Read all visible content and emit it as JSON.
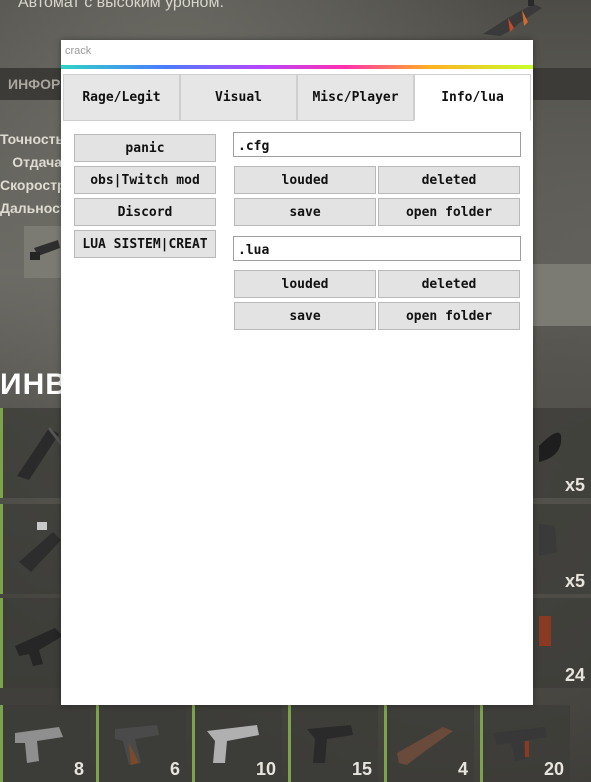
{
  "background": {
    "subtitle": "Автомат с высоким уроном.",
    "info_tab": "ИНФОРМАЦИЯ",
    "stats": [
      "Точность",
      "Отдача",
      "Скорострельность",
      "Дальность"
    ],
    "inventory_title": "ИНВЕНТАРЬ",
    "inventory_counts": {
      "r1_right": "x5",
      "r2_right": "x5",
      "r3_right": "24",
      "b1": "8",
      "b2": "6",
      "b3": "10",
      "b4": "15",
      "b5": "4",
      "b6": "20"
    }
  },
  "window": {
    "title": "crack",
    "tabs": [
      "Rage/Legit",
      "Visual",
      "Misc/Player",
      "Info/lua"
    ],
    "active_tab": "Info/lua"
  },
  "left_buttons": {
    "panic": "panic",
    "obs": "obs|Twitch mod",
    "discord": "Discord",
    "lua_sistem": "LUA SISTEM|CREAT"
  },
  "cfg": {
    "input_value": ".cfg",
    "load": "louded",
    "delete": "deleted",
    "save": "save",
    "open_folder": "open folder"
  },
  "lua": {
    "input_value": ".lua",
    "load": "louded",
    "delete": "deleted",
    "save": "save",
    "open_folder": "open folder"
  },
  "colors": {
    "accent_gradient": [
      "#2fd3c5",
      "#4a7cff",
      "#b347ff",
      "#ff2fb0",
      "#ffb020",
      "#c8ff2a"
    ],
    "inventory_slot_border": "#7aa34a"
  }
}
